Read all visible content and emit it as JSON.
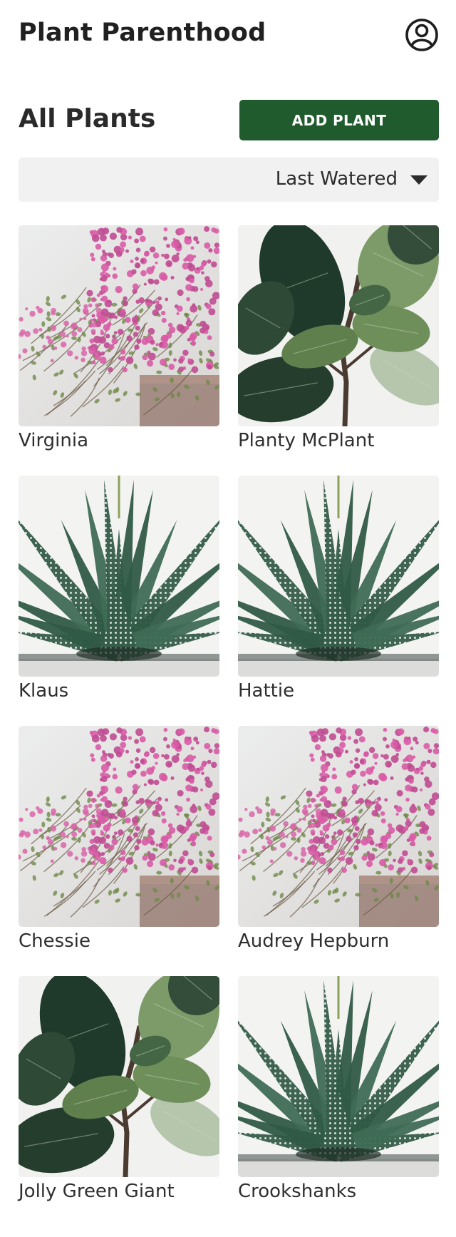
{
  "header": {
    "title": "Plant Parenthood",
    "profile_icon": "user-circle-icon"
  },
  "toolbar": {
    "section_title": "All Plants",
    "add_button_label": "ADD PLANT"
  },
  "sort": {
    "selected": "Last Watered",
    "caret_icon": "triangle-down-icon"
  },
  "colors": {
    "accent": "#1f5b2c",
    "sort_background": "#f0f1f0",
    "text": "#2f2f2f"
  },
  "plants": [
    {
      "name": "Virginia",
      "image": "pink-flowering-plant"
    },
    {
      "name": "Planty McPlant",
      "image": "fiddle-leaf-fig"
    },
    {
      "name": "Klaus",
      "image": "zebra-succulent"
    },
    {
      "name": "Hattie",
      "image": "zebra-succulent"
    },
    {
      "name": "Chessie",
      "image": "pink-flowering-plant"
    },
    {
      "name": "Audrey Hepburn",
      "image": "pink-flowering-plant"
    },
    {
      "name": "Jolly Green Giant",
      "image": "fiddle-leaf-fig"
    },
    {
      "name": "Crookshanks",
      "image": "zebra-succulent"
    }
  ]
}
